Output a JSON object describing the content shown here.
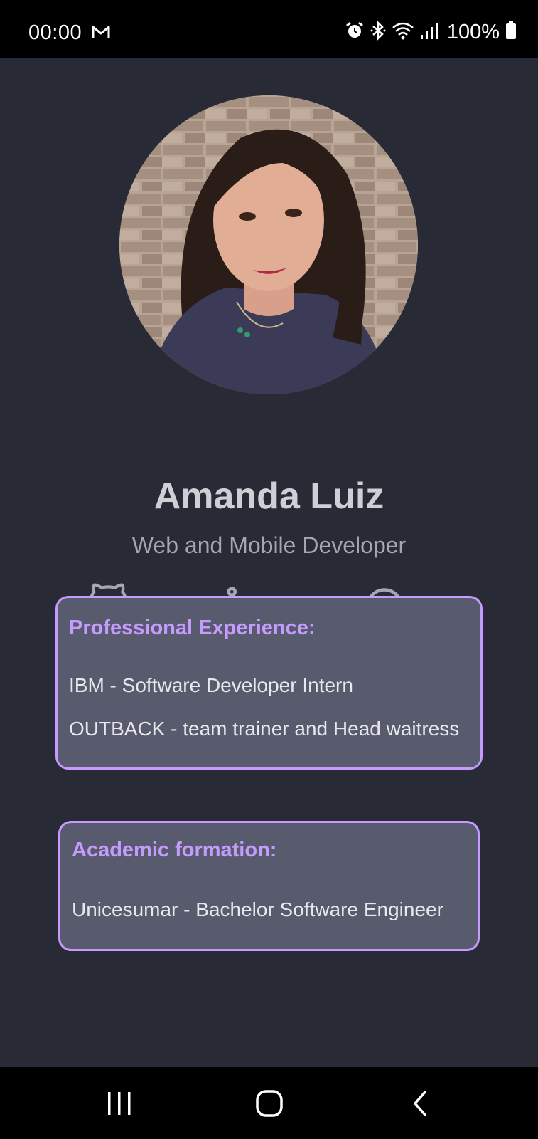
{
  "status_bar": {
    "time": "00:00",
    "left_icons": [
      "gmail-icon"
    ],
    "right_icons": [
      "alarm-icon",
      "bluetooth-icon",
      "wifi-icon",
      "signal-icon",
      "battery-icon"
    ],
    "battery": "100%"
  },
  "profile": {
    "name": "Amanda Luiz",
    "subtitle": "Web and Mobile Developer",
    "photo": "profile-photo"
  },
  "social_links": [
    "github-icon",
    "linkedin-icon",
    "whatsapp-icon"
  ],
  "experience": {
    "title": "Professional Experience:",
    "items": [
      "IBM - Software Developer Intern",
      "OUTBACK - team trainer and Head waitress"
    ]
  },
  "academic": {
    "title": "Academic formation:",
    "items": [
      "Unicesumar - Bachelor Software Engineer"
    ]
  },
  "navigation": [
    "recent-apps-icon",
    "home-icon",
    "back-icon"
  ],
  "colors": {
    "background": "#282a36",
    "accent": "#c59bff",
    "card": "#585b6d",
    "name_text": "#cfd0d6",
    "subtitle_text": "#a4a6b1"
  }
}
